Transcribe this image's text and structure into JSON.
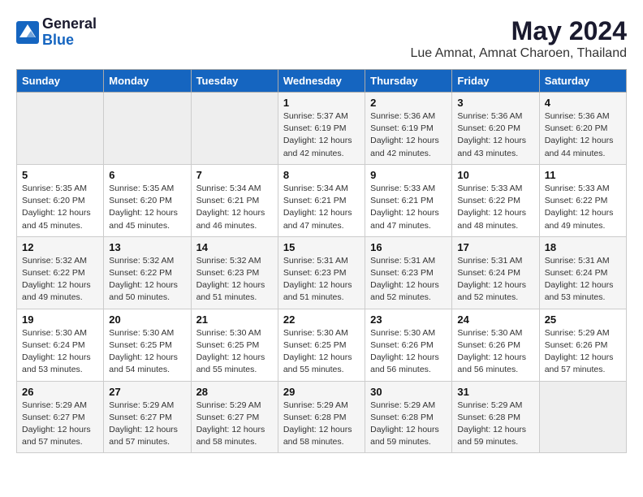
{
  "logo": {
    "general": "General",
    "blue": "Blue"
  },
  "title": "May 2024",
  "subtitle": "Lue Amnat, Amnat Charoen, Thailand",
  "headers": [
    "Sunday",
    "Monday",
    "Tuesday",
    "Wednesday",
    "Thursday",
    "Friday",
    "Saturday"
  ],
  "weeks": [
    [
      {
        "day": "",
        "info": ""
      },
      {
        "day": "",
        "info": ""
      },
      {
        "day": "",
        "info": ""
      },
      {
        "day": "1",
        "info": "Sunrise: 5:37 AM\nSunset: 6:19 PM\nDaylight: 12 hours\nand 42 minutes."
      },
      {
        "day": "2",
        "info": "Sunrise: 5:36 AM\nSunset: 6:19 PM\nDaylight: 12 hours\nand 42 minutes."
      },
      {
        "day": "3",
        "info": "Sunrise: 5:36 AM\nSunset: 6:20 PM\nDaylight: 12 hours\nand 43 minutes."
      },
      {
        "day": "4",
        "info": "Sunrise: 5:36 AM\nSunset: 6:20 PM\nDaylight: 12 hours\nand 44 minutes."
      }
    ],
    [
      {
        "day": "5",
        "info": "Sunrise: 5:35 AM\nSunset: 6:20 PM\nDaylight: 12 hours\nand 45 minutes."
      },
      {
        "day": "6",
        "info": "Sunrise: 5:35 AM\nSunset: 6:20 PM\nDaylight: 12 hours\nand 45 minutes."
      },
      {
        "day": "7",
        "info": "Sunrise: 5:34 AM\nSunset: 6:21 PM\nDaylight: 12 hours\nand 46 minutes."
      },
      {
        "day": "8",
        "info": "Sunrise: 5:34 AM\nSunset: 6:21 PM\nDaylight: 12 hours\nand 47 minutes."
      },
      {
        "day": "9",
        "info": "Sunrise: 5:33 AM\nSunset: 6:21 PM\nDaylight: 12 hours\nand 47 minutes."
      },
      {
        "day": "10",
        "info": "Sunrise: 5:33 AM\nSunset: 6:22 PM\nDaylight: 12 hours\nand 48 minutes."
      },
      {
        "day": "11",
        "info": "Sunrise: 5:33 AM\nSunset: 6:22 PM\nDaylight: 12 hours\nand 49 minutes."
      }
    ],
    [
      {
        "day": "12",
        "info": "Sunrise: 5:32 AM\nSunset: 6:22 PM\nDaylight: 12 hours\nand 49 minutes."
      },
      {
        "day": "13",
        "info": "Sunrise: 5:32 AM\nSunset: 6:22 PM\nDaylight: 12 hours\nand 50 minutes."
      },
      {
        "day": "14",
        "info": "Sunrise: 5:32 AM\nSunset: 6:23 PM\nDaylight: 12 hours\nand 51 minutes."
      },
      {
        "day": "15",
        "info": "Sunrise: 5:31 AM\nSunset: 6:23 PM\nDaylight: 12 hours\nand 51 minutes."
      },
      {
        "day": "16",
        "info": "Sunrise: 5:31 AM\nSunset: 6:23 PM\nDaylight: 12 hours\nand 52 minutes."
      },
      {
        "day": "17",
        "info": "Sunrise: 5:31 AM\nSunset: 6:24 PM\nDaylight: 12 hours\nand 52 minutes."
      },
      {
        "day": "18",
        "info": "Sunrise: 5:31 AM\nSunset: 6:24 PM\nDaylight: 12 hours\nand 53 minutes."
      }
    ],
    [
      {
        "day": "19",
        "info": "Sunrise: 5:30 AM\nSunset: 6:24 PM\nDaylight: 12 hours\nand 53 minutes."
      },
      {
        "day": "20",
        "info": "Sunrise: 5:30 AM\nSunset: 6:25 PM\nDaylight: 12 hours\nand 54 minutes."
      },
      {
        "day": "21",
        "info": "Sunrise: 5:30 AM\nSunset: 6:25 PM\nDaylight: 12 hours\nand 55 minutes."
      },
      {
        "day": "22",
        "info": "Sunrise: 5:30 AM\nSunset: 6:25 PM\nDaylight: 12 hours\nand 55 minutes."
      },
      {
        "day": "23",
        "info": "Sunrise: 5:30 AM\nSunset: 6:26 PM\nDaylight: 12 hours\nand 56 minutes."
      },
      {
        "day": "24",
        "info": "Sunrise: 5:30 AM\nSunset: 6:26 PM\nDaylight: 12 hours\nand 56 minutes."
      },
      {
        "day": "25",
        "info": "Sunrise: 5:29 AM\nSunset: 6:26 PM\nDaylight: 12 hours\nand 57 minutes."
      }
    ],
    [
      {
        "day": "26",
        "info": "Sunrise: 5:29 AM\nSunset: 6:27 PM\nDaylight: 12 hours\nand 57 minutes."
      },
      {
        "day": "27",
        "info": "Sunrise: 5:29 AM\nSunset: 6:27 PM\nDaylight: 12 hours\nand 57 minutes."
      },
      {
        "day": "28",
        "info": "Sunrise: 5:29 AM\nSunset: 6:27 PM\nDaylight: 12 hours\nand 58 minutes."
      },
      {
        "day": "29",
        "info": "Sunrise: 5:29 AM\nSunset: 6:28 PM\nDaylight: 12 hours\nand 58 minutes."
      },
      {
        "day": "30",
        "info": "Sunrise: 5:29 AM\nSunset: 6:28 PM\nDaylight: 12 hours\nand 59 minutes."
      },
      {
        "day": "31",
        "info": "Sunrise: 5:29 AM\nSunset: 6:28 PM\nDaylight: 12 hours\nand 59 minutes."
      },
      {
        "day": "",
        "info": ""
      }
    ]
  ]
}
